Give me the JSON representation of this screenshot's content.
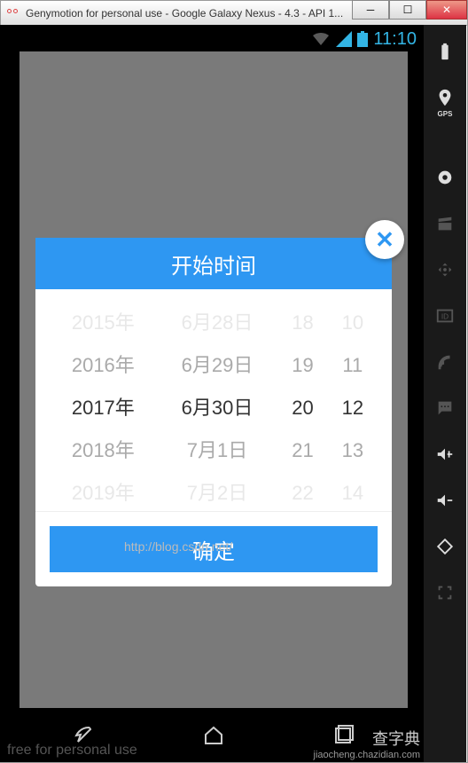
{
  "window": {
    "title": "Genymotion for personal use - Google Galaxy Nexus - 4.3 - API 1..."
  },
  "statusbar": {
    "time": "11:10"
  },
  "sidebar": {
    "gps_label": "GPS",
    "id_label": "ID"
  },
  "dialog": {
    "title": "开始时间",
    "close": "✕",
    "confirm": "确定",
    "watermark": "http://blog.csdn.net/",
    "picker": {
      "year": {
        "opts": [
          "2015年",
          "2016年",
          "2017年",
          "2018年",
          "2019年"
        ],
        "sel": 2
      },
      "date": {
        "opts": [
          "6月28日",
          "6月29日",
          "6月30日",
          "7月1日",
          "7月2日"
        ],
        "sel": 2
      },
      "hour": {
        "opts": [
          "18",
          "19",
          "20",
          "21",
          "22"
        ],
        "sel": 2
      },
      "minute": {
        "opts": [
          "10",
          "11",
          "12",
          "13",
          "14"
        ],
        "sel": 2
      }
    }
  },
  "footer": {
    "brand": "free for personal use",
    "corner1": "查字典",
    "corner2": "jiaocheng.chazidian.com"
  }
}
